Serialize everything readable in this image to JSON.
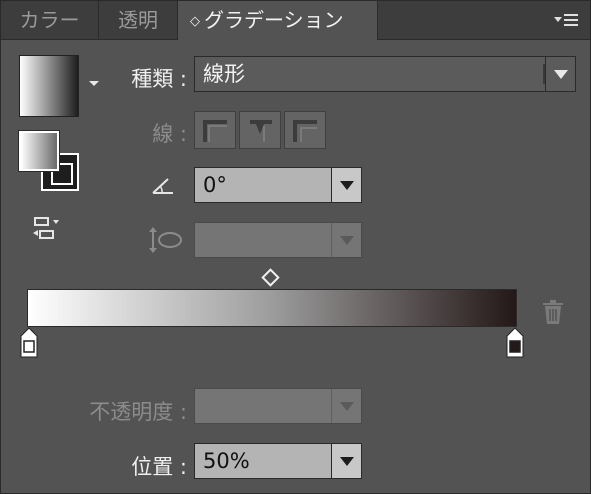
{
  "tabs": [
    {
      "label": "カラー",
      "active": false
    },
    {
      "label": "透明",
      "active": false
    },
    {
      "label": "グラデーション",
      "active": true
    }
  ],
  "tab_active_prefix": "◇",
  "type_row": {
    "label": "種類 :",
    "value": "線形"
  },
  "stroke_row": {
    "label": "線 :"
  },
  "angle_row": {
    "icon": "angle-icon",
    "value": "0°"
  },
  "aspect_row": {
    "icon": "aspect-ratio-icon",
    "value": ""
  },
  "gradient_slider": {
    "stops": [
      {
        "color": "#ffffff",
        "location": 0
      },
      {
        "color": "#241818",
        "location": 100
      }
    ],
    "midpoint": 50
  },
  "opacity_row": {
    "label": "不透明度 :",
    "value": ""
  },
  "location_row": {
    "label": "位置 :",
    "value": "50%"
  },
  "colors": {
    "panel": "#535353",
    "tabbar": "#3d3d3d",
    "field_light": "#b4b4b4"
  }
}
